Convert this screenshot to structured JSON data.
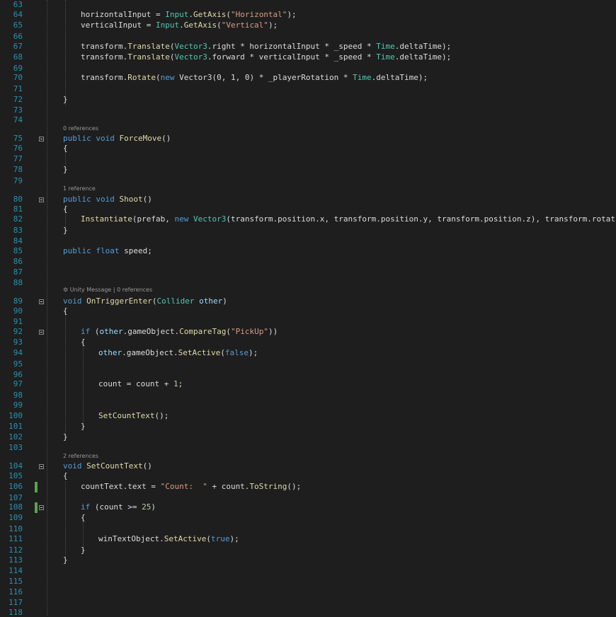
{
  "gutter": {
    "line_numbers": [
      "63",
      "64",
      "65",
      "66",
      "67",
      "68",
      "69",
      "70",
      "71",
      "72",
      "73",
      "74",
      "75",
      "76",
      "77",
      "78",
      "79",
      "80",
      "81",
      "82",
      "83",
      "84",
      "85",
      "86",
      "87",
      "88",
      "89",
      "90",
      "91",
      "92",
      "93",
      "94",
      "95",
      "96",
      "97",
      "98",
      "99",
      "100",
      "101",
      "102",
      "103",
      "104",
      "105",
      "106",
      "107",
      "108",
      "109",
      "110",
      "111",
      "112",
      "113",
      "114",
      "115",
      "116",
      "117",
      "118"
    ]
  },
  "codelens": {
    "force_move": "0 references",
    "shoot": "1 reference",
    "on_trigger_enter": "Unity Message | 0 references",
    "set_count_text": "2 references"
  },
  "code": {
    "l64": [
      {
        "t": "horizontalInput = ",
        "c": ""
      },
      {
        "t": "Input",
        "c": "ty"
      },
      {
        "t": ".",
        "c": ""
      },
      {
        "t": "GetAxis",
        "c": "fn"
      },
      {
        "t": "(",
        "c": ""
      },
      {
        "t": "\"Horizontal\"",
        "c": "st"
      },
      {
        "t": ");",
        "c": ""
      }
    ],
    "l65": [
      {
        "t": "verticalInput = ",
        "c": ""
      },
      {
        "t": "Input",
        "c": "ty"
      },
      {
        "t": ".",
        "c": ""
      },
      {
        "t": "GetAxis",
        "c": "fn"
      },
      {
        "t": "(",
        "c": ""
      },
      {
        "t": "\"Vertical\"",
        "c": "st"
      },
      {
        "t": ");",
        "c": ""
      }
    ],
    "l67": [
      {
        "t": "transform.",
        "c": ""
      },
      {
        "t": "Translate",
        "c": "fn"
      },
      {
        "t": "(",
        "c": ""
      },
      {
        "t": "Vector3",
        "c": "ty"
      },
      {
        "t": ".right * horizontalInput * _speed * ",
        "c": ""
      },
      {
        "t": "Time",
        "c": "ty"
      },
      {
        "t": ".deltaTime);",
        "c": ""
      }
    ],
    "l68": [
      {
        "t": "transform.",
        "c": ""
      },
      {
        "t": "Translate",
        "c": "fn"
      },
      {
        "t": "(",
        "c": ""
      },
      {
        "t": "Vector3",
        "c": "ty"
      },
      {
        "t": ".forward * verticalInput * _speed * ",
        "c": ""
      },
      {
        "t": "Time",
        "c": "ty"
      },
      {
        "t": ".deltaTime);",
        "c": ""
      }
    ],
    "l70": [
      {
        "t": "transform.",
        "c": ""
      },
      {
        "t": "Rotate",
        "c": "fn"
      },
      {
        "t": "(",
        "c": ""
      },
      {
        "t": "new",
        "c": "kw"
      },
      {
        "t": " Vector3(0, 1, 0) * _playerRotation * ",
        "c": ""
      },
      {
        "t": "Time",
        "c": "ty"
      },
      {
        "t": ".deltaTime);",
        "c": ""
      }
    ],
    "l72": [
      {
        "t": "}",
        "c": ""
      }
    ],
    "l75": [
      {
        "t": "public",
        "c": "kw"
      },
      {
        "t": " ",
        "c": ""
      },
      {
        "t": "void",
        "c": "kw"
      },
      {
        "t": " ",
        "c": ""
      },
      {
        "t": "ForceMove",
        "c": "fn"
      },
      {
        "t": "()",
        "c": ""
      }
    ],
    "l76": [
      {
        "t": "{",
        "c": ""
      }
    ],
    "l78": [
      {
        "t": "}",
        "c": ""
      }
    ],
    "l80": [
      {
        "t": "public",
        "c": "kw"
      },
      {
        "t": " ",
        "c": ""
      },
      {
        "t": "void",
        "c": "kw"
      },
      {
        "t": " ",
        "c": ""
      },
      {
        "t": "Shoot",
        "c": "fn"
      },
      {
        "t": "()",
        "c": ""
      }
    ],
    "l81": [
      {
        "t": "{",
        "c": ""
      }
    ],
    "l82": [
      {
        "t": "Instantiate",
        "c": "fn"
      },
      {
        "t": "(prefab, ",
        "c": ""
      },
      {
        "t": "new",
        "c": "kw"
      },
      {
        "t": " ",
        "c": ""
      },
      {
        "t": "Vector3",
        "c": "ty"
      },
      {
        "t": "(transform.position.x, transform.position.y, transform.position.z), transform.rotation);",
        "c": ""
      }
    ],
    "l83": [
      {
        "t": "}",
        "c": ""
      }
    ],
    "l85": [
      {
        "t": "public",
        "c": "kw"
      },
      {
        "t": " ",
        "c": ""
      },
      {
        "t": "float",
        "c": "kw"
      },
      {
        "t": " speed;",
        "c": ""
      }
    ],
    "l89": [
      {
        "t": "void",
        "c": "kw"
      },
      {
        "t": " ",
        "c": ""
      },
      {
        "t": "OnTriggerEnter",
        "c": "fn"
      },
      {
        "t": "(",
        "c": ""
      },
      {
        "t": "Collider",
        "c": "ty"
      },
      {
        "t": " ",
        "c": ""
      },
      {
        "t": "other",
        "c": "pr"
      },
      {
        "t": ")",
        "c": ""
      }
    ],
    "l90": [
      {
        "t": "{",
        "c": ""
      }
    ],
    "l92": [
      {
        "t": "if",
        "c": "kw"
      },
      {
        "t": " (",
        "c": ""
      },
      {
        "t": "other",
        "c": "pr"
      },
      {
        "t": ".gameObject.",
        "c": ""
      },
      {
        "t": "CompareTag",
        "c": "fn"
      },
      {
        "t": "(",
        "c": ""
      },
      {
        "t": "\"PickUp\"",
        "c": "st"
      },
      {
        "t": "))",
        "c": ""
      }
    ],
    "l93": [
      {
        "t": "{",
        "c": ""
      }
    ],
    "l94": [
      {
        "t": "other",
        "c": "pr"
      },
      {
        "t": ".gameObject.",
        "c": ""
      },
      {
        "t": "SetActive",
        "c": "fn"
      },
      {
        "t": "(",
        "c": ""
      },
      {
        "t": "false",
        "c": "kw"
      },
      {
        "t": ");",
        "c": ""
      }
    ],
    "l97": [
      {
        "t": "count = count + ",
        "c": ""
      },
      {
        "t": "1",
        "c": "nm"
      },
      {
        "t": ";",
        "c": ""
      }
    ],
    "l100": [
      {
        "t": "SetCountText",
        "c": "fn"
      },
      {
        "t": "();",
        "c": ""
      }
    ],
    "l101": [
      {
        "t": "}",
        "c": ""
      }
    ],
    "l102": [
      {
        "t": "}",
        "c": ""
      }
    ],
    "l104": [
      {
        "t": "void",
        "c": "kw"
      },
      {
        "t": " ",
        "c": ""
      },
      {
        "t": "SetCountText",
        "c": "fn"
      },
      {
        "t": "()",
        "c": ""
      }
    ],
    "l105": [
      {
        "t": "{",
        "c": ""
      }
    ],
    "l106": [
      {
        "t": "countText.text = ",
        "c": ""
      },
      {
        "t": "\"Count:  \"",
        "c": "st"
      },
      {
        "t": " + count.",
        "c": ""
      },
      {
        "t": "ToString",
        "c": "fn"
      },
      {
        "t": "();",
        "c": ""
      }
    ],
    "l108": [
      {
        "t": "if",
        "c": "kw"
      },
      {
        "t": " (count >= ",
        "c": ""
      },
      {
        "t": "25",
        "c": "nm"
      },
      {
        "t": ")",
        "c": ""
      }
    ],
    "l109": [
      {
        "t": "{",
        "c": ""
      }
    ],
    "l111": [
      {
        "t": "winTextObject.",
        "c": ""
      },
      {
        "t": "SetActive",
        "c": "fn"
      },
      {
        "t": "(",
        "c": ""
      },
      {
        "t": "true",
        "c": "kw"
      },
      {
        "t": ");",
        "c": ""
      }
    ],
    "l112": [
      {
        "t": "}",
        "c": ""
      }
    ],
    "l113": [
      {
        "t": "}",
        "c": ""
      }
    ]
  }
}
